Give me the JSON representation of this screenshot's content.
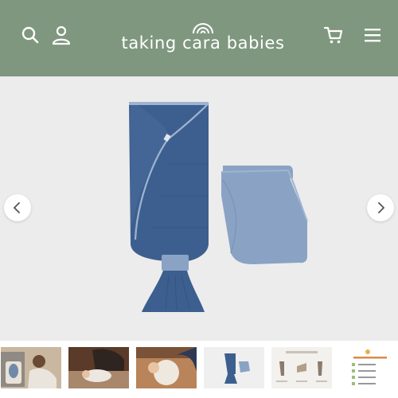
{
  "header": {
    "brand": "taking cara babies",
    "background_color": "#7f977f",
    "left_icons": [
      "search-icon",
      "account-icon"
    ],
    "right_icons": [
      "cart-icon",
      "menu-icon"
    ]
  },
  "carousel": {
    "product_image": "zipadee-style swaddle sack with separate blue blanket",
    "prev_icon": "chevron-left-icon",
    "next_icon": "chevron-right-icon",
    "thumbnails": [
      "baby-on-bed-photo",
      "parent-swaddling-photo",
      "baby-in-swaddle-photo",
      "product-flatlay-thumbnail",
      "how-to-swaddle-infographic",
      "swaddle-checklist-infographic"
    ]
  }
}
